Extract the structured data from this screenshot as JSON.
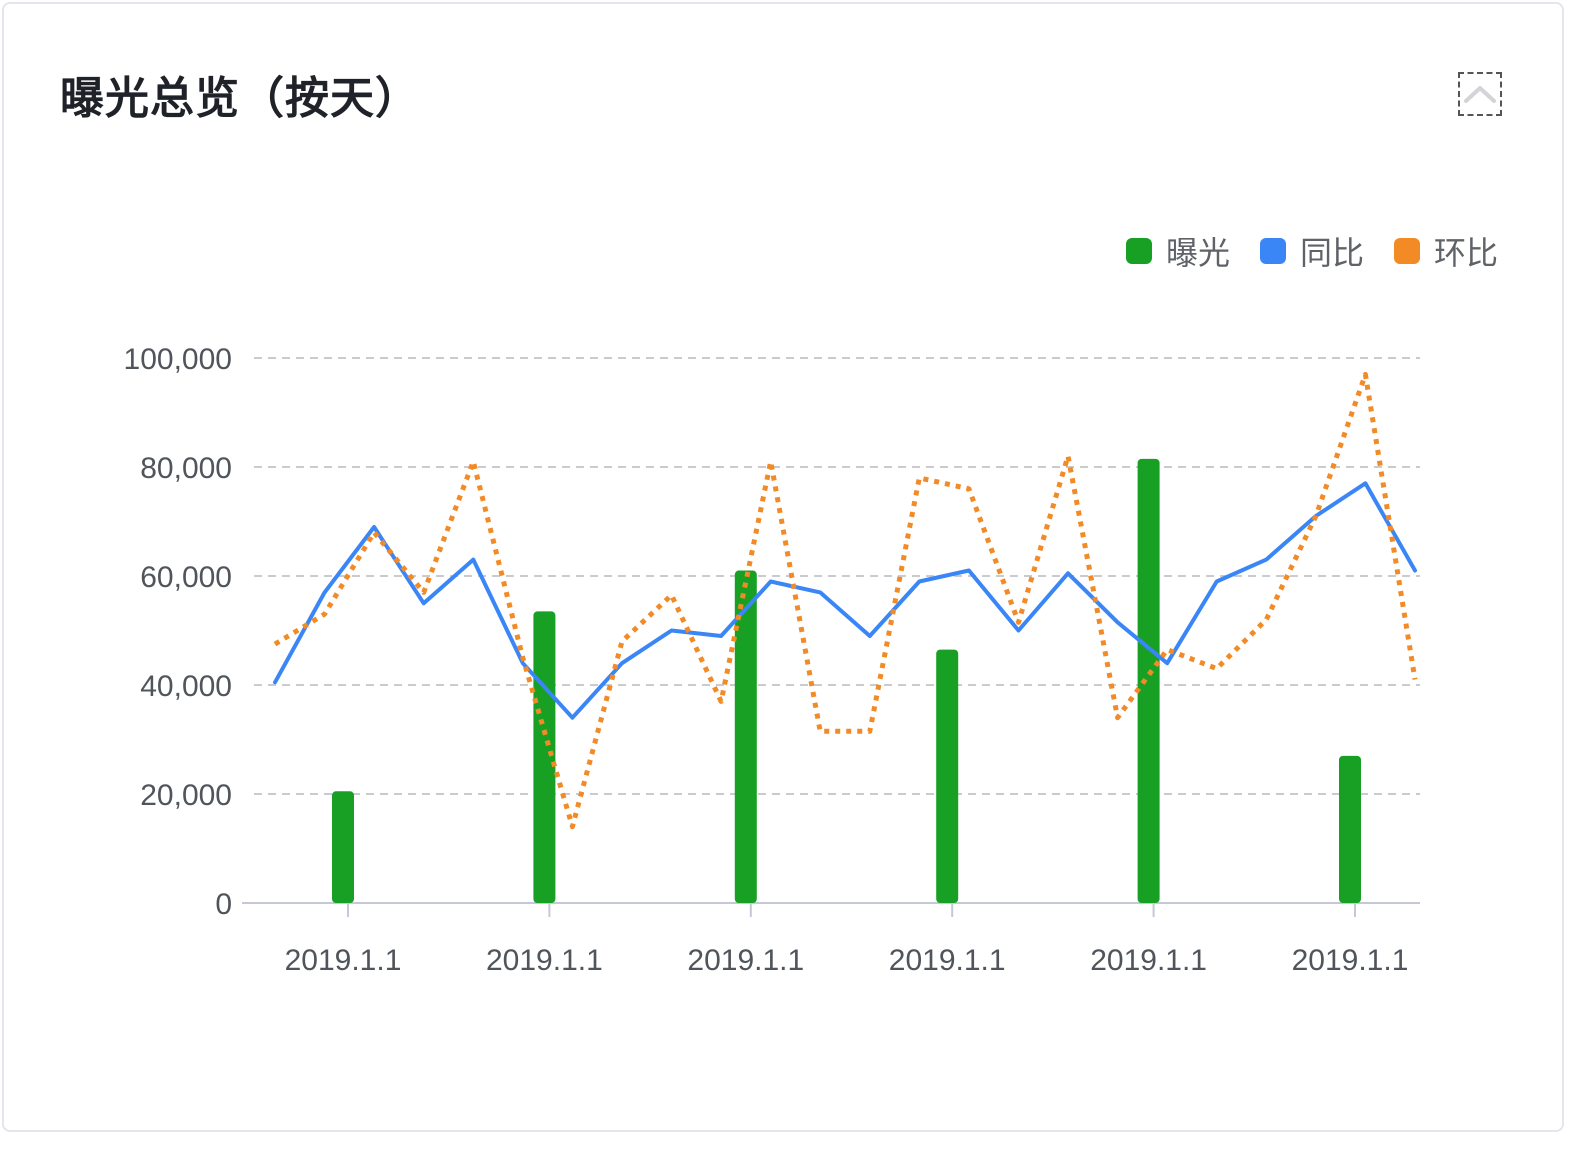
{
  "card": {
    "title": "曝光总览（按天）"
  },
  "controls": {
    "collapse_icon": "chevron-up-icon"
  },
  "chart_data": {
    "type": "bar",
    "title": "曝光总览（按天）",
    "y_ticks": [
      "0",
      "20,000",
      "40,000",
      "60,000",
      "80,000",
      "100,000"
    ],
    "ylim": [
      0,
      100000
    ],
    "grid": true,
    "legend_position": "top-right",
    "x_tick_labels": [
      "2019.1.1",
      "2019.1.1",
      "2019.1.1",
      "2019.1.1",
      "2019.1.1",
      "2019.1.1"
    ],
    "series": [
      {
        "name": "曝光",
        "kind": "bar",
        "color": "#18a025",
        "values": [
          20500,
          53500,
          61000,
          46500,
          81500,
          27000
        ]
      },
      {
        "name": "同比",
        "kind": "line",
        "color": "#3a86f7",
        "style": "solid",
        "values": [
          40500,
          57000,
          69000,
          55000,
          63000,
          44000,
          34000,
          44000,
          50000,
          49000,
          59000,
          57000,
          49000,
          59000,
          61000,
          50000,
          60500,
          51500,
          44000,
          59000,
          63000,
          71000,
          77000,
          61000
        ]
      },
      {
        "name": "环比",
        "kind": "line",
        "color": "#f28a26",
        "style": "dotted",
        "values": [
          47500,
          53000,
          68000,
          57000,
          81000,
          45000,
          14000,
          48000,
          56500,
          37000,
          81000,
          31500,
          31500,
          78000,
          76000,
          51500,
          82000,
          34000,
          46500,
          43000,
          52000,
          71000,
          97000,
          41000
        ]
      }
    ]
  }
}
